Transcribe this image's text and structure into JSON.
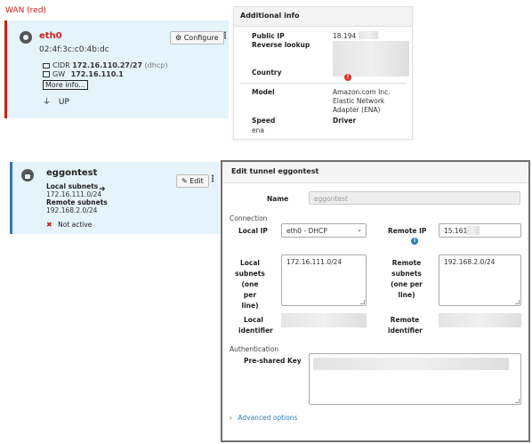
{
  "wan": {
    "title": "WAN (red)",
    "iface": {
      "name": "eth0",
      "mac": "02:4f:3c:c0:4b:dc",
      "cidr_label": "CIDR",
      "cidr_value": "172.16.110.27/27",
      "cidr_mode": "(dhcp)",
      "gw_label": "GW",
      "gw_value": "172.16.110.1",
      "more_info": "More info...",
      "status": "UP",
      "configure_label": "Configure",
      "icons": {
        "globe": "globe-icon",
        "gear": "gear-icon",
        "monitor": "monitor-icon",
        "network": "network-icon",
        "plug": "plug-icon",
        "menu": "kebab-menu-icon"
      }
    }
  },
  "additional_info": {
    "title": "Additional info",
    "public_ip_label": "Public IP",
    "public_ip_value": "18.194",
    "reverse_lookup_label": "Reverse lookup",
    "country_label": "Country",
    "model_label": "Model",
    "model_value_1": "Amazon.com Inc.",
    "model_value_2": "Elastic Network",
    "model_value_3": "Adapter (ENA)",
    "speed_label": "Speed",
    "driver_label": "Driver",
    "driver_value": "ena",
    "warning_glyph": "!"
  },
  "vpn": {
    "name": "eggontest",
    "local_label": "Local subnets",
    "local_value": "172.16.111.0/24",
    "remote_label": "Remote subnets",
    "remote_value": "192.168.2.0/24",
    "status": "Not active",
    "edit_label": "Edit",
    "icons": {
      "lock": "lock-icon",
      "arrow": "arrow-right-icon",
      "pencil": "pencil-icon",
      "x": "close-x-icon"
    }
  },
  "dialog": {
    "title": "Edit tunnel eggontest",
    "name_label": "Name",
    "name_value": "eggontest",
    "connection_section": "Connection",
    "local_ip_label": "Local IP",
    "local_ip_value": "eth0 - DHCP",
    "remote_ip_label": "Remote IP",
    "remote_ip_value": "15.161",
    "local_subnets_label_1": "Local",
    "local_subnets_label_2": "subnets",
    "local_subnets_label_3": "(one per",
    "local_subnets_label_4": "line)",
    "local_subnets_value": "172.16.111.0/24",
    "remote_subnets_label_1": "Remote",
    "remote_subnets_label_2": "subnets",
    "remote_subnets_label_3": "(one per",
    "remote_subnets_label_4": "line)",
    "remote_subnets_value": "192.168.2.0/24",
    "local_identifier_label_1": "Local",
    "local_identifier_label_2": "identifier",
    "remote_identifier_label_1": "Remote",
    "remote_identifier_label_2": "identifier",
    "auth_section": "Authentication",
    "psk_label": "Pre-shared Key",
    "advanced_label": "Advanced options",
    "info_glyph": "i"
  }
}
